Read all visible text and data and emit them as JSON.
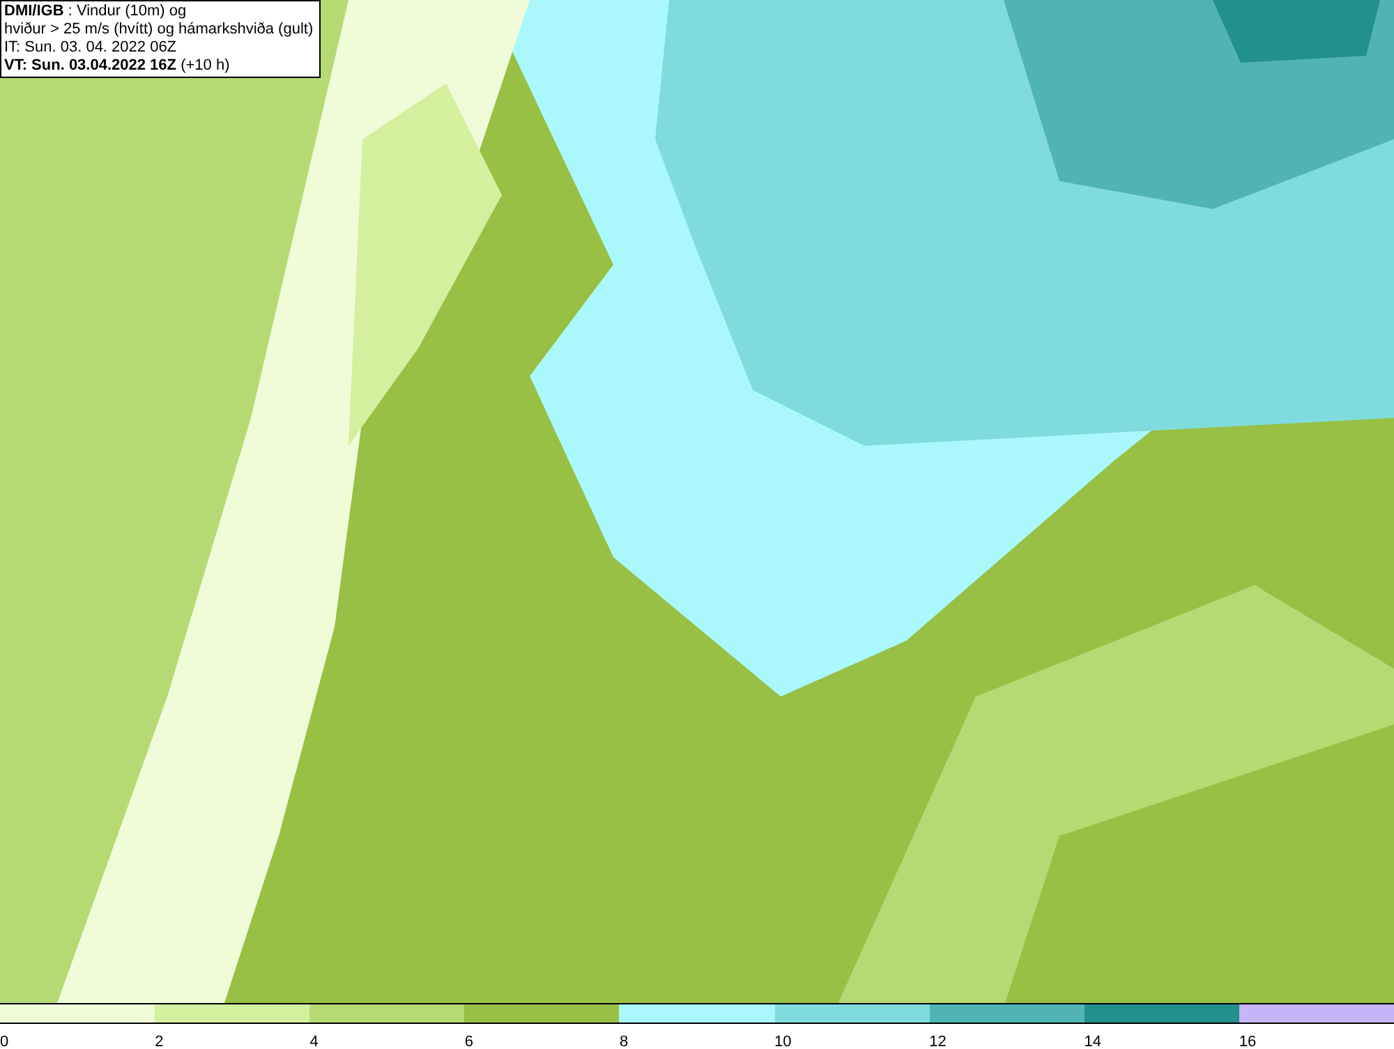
{
  "info_box": {
    "lines": [
      "**DMI/IGB** : Vindur (10m) og",
      "hviður > 25 m/s (hvítt) og hámarkshviða (gult)",
      "IT: Sun. 03. 04. 2022 06Z",
      "**VT: Sun. 03.04.2022 16Z** (+10 h)"
    ]
  },
  "legend": {
    "segments": [
      {
        "color": "#f0fbd8"
      },
      {
        "color": "#d4ef9e"
      },
      {
        "color": "#b5da74"
      },
      {
        "color": "#97c044"
      },
      {
        "color": "#aaf8fc"
      },
      {
        "color": "#80dcdc"
      },
      {
        "color": "#50b4b4"
      },
      {
        "color": "#22908c"
      },
      {
        "color": "#c4b4f8"
      }
    ],
    "labels": [
      "0",
      "2",
      "4",
      "6",
      "8",
      "10",
      "12",
      "14",
      "16"
    ]
  }
}
